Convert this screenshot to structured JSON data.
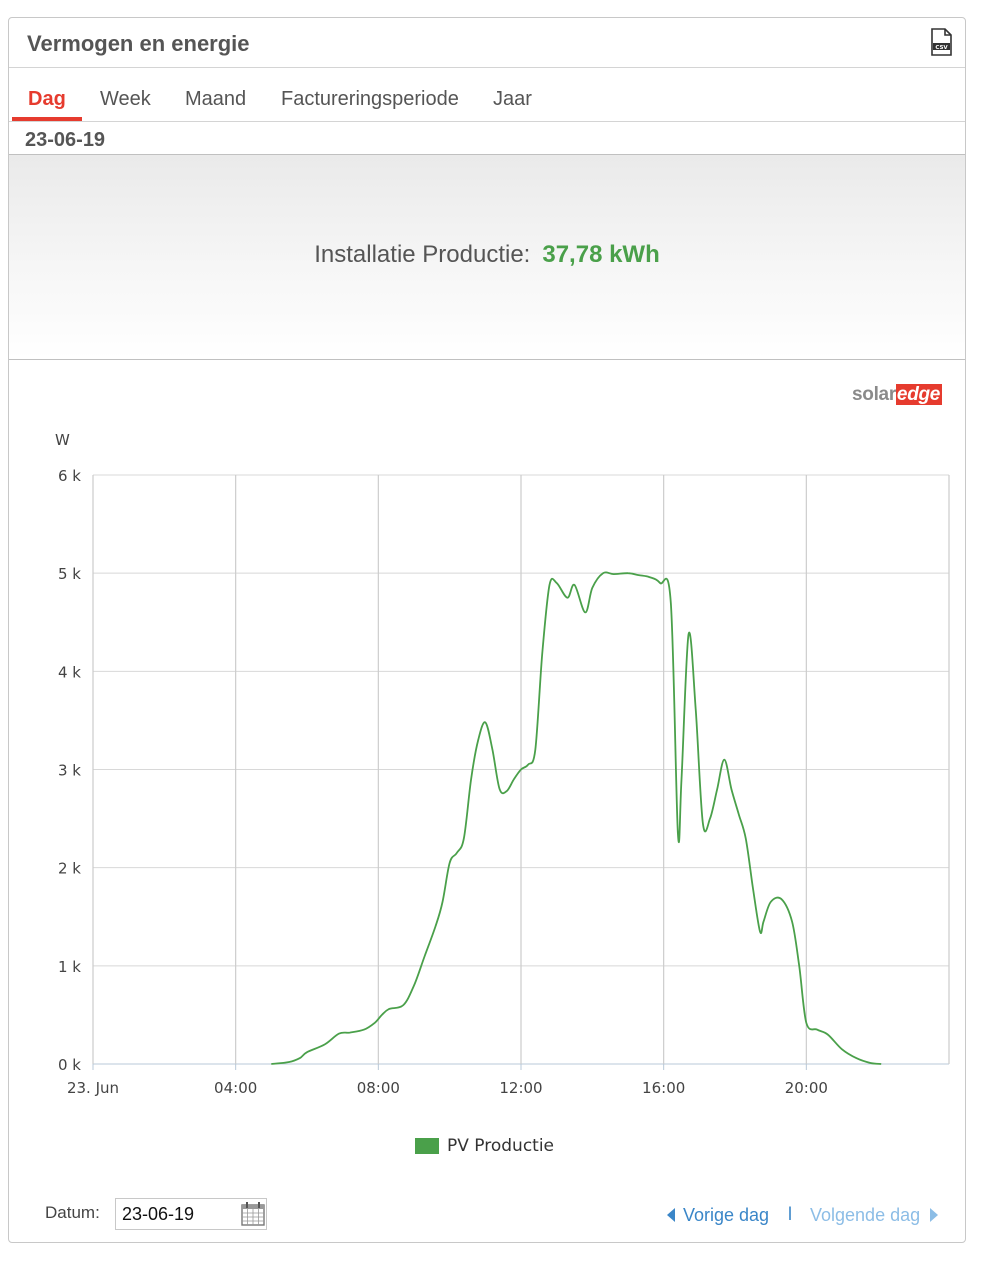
{
  "panel": {
    "title": "Vermogen en energie",
    "export_icon": "csv-file-icon"
  },
  "tabs": [
    {
      "label": "Dag",
      "active": true
    },
    {
      "label": "Week",
      "active": false
    },
    {
      "label": "Maand",
      "active": false
    },
    {
      "label": "Factureringsperiode",
      "active": false
    },
    {
      "label": "Jaar",
      "active": false
    }
  ],
  "period": {
    "date": "23-06-19"
  },
  "summary": {
    "label": "Installatie Productie:",
    "value": "37,78 kWh"
  },
  "logo": {
    "part1": "solar",
    "part2": "edge"
  },
  "colors": {
    "accent": "#e63b2e",
    "series": "#4aa04a",
    "link": "#3a86c8",
    "link_disabled": "#8cbde6"
  },
  "chart_data": {
    "type": "area",
    "ylabel": "W",
    "ylim": [
      0,
      6000
    ],
    "yticks": [
      0,
      1000,
      2000,
      3000,
      4000,
      5000,
      6000
    ],
    "ytick_labels": [
      "0 k",
      "1 k",
      "2 k",
      "3 k",
      "4 k",
      "5 k",
      "6 k"
    ],
    "xlim": [
      0,
      24
    ],
    "xticks": [
      0,
      4,
      8,
      12,
      16,
      20
    ],
    "xtick_labels": [
      "23. Jun",
      "04:00",
      "08:00",
      "12:00",
      "16:00",
      "20:00"
    ],
    "grid": true,
    "legend_position": "bottom-center",
    "series": [
      {
        "name": "PV Productie",
        "color": "#4aa04a",
        "x": [
          0,
          5.0,
          5.5,
          5.8,
          6.0,
          6.5,
          6.9,
          7.2,
          7.6,
          7.9,
          8.1,
          8.3,
          8.7,
          9.0,
          9.3,
          9.6,
          9.8,
          10.0,
          10.2,
          10.4,
          10.6,
          10.8,
          11.0,
          11.2,
          11.4,
          11.6,
          11.8,
          12.0,
          12.2,
          12.4,
          12.6,
          12.8,
          13.0,
          13.3,
          13.5,
          13.8,
          14.0,
          14.3,
          14.6,
          15.0,
          15.3,
          15.6,
          15.9,
          16.2,
          16.4,
          16.5,
          16.7,
          16.9,
          17.1,
          17.3,
          17.5,
          17.7,
          17.9,
          18.1,
          18.3,
          18.5,
          18.7,
          18.8,
          19.0,
          19.3,
          19.6,
          19.8,
          20.0,
          20.3,
          20.6,
          21.0,
          21.4,
          21.8,
          22.1
        ],
        "values": [
          0,
          0,
          20,
          60,
          120,
          200,
          310,
          320,
          350,
          420,
          500,
          560,
          600,
          800,
          1100,
          1400,
          1650,
          2050,
          2150,
          2300,
          2900,
          3300,
          3480,
          3200,
          2800,
          2780,
          2900,
          3000,
          3050,
          3200,
          4200,
          4880,
          4900,
          4750,
          4880,
          4600,
          4850,
          5000,
          4990,
          5000,
          4980,
          4960,
          4900,
          4700,
          2350,
          2900,
          4380,
          3600,
          2450,
          2500,
          2800,
          3100,
          2800,
          2550,
          2300,
          1800,
          1350,
          1450,
          1650,
          1680,
          1450,
          1000,
          420,
          350,
          300,
          150,
          60,
          10,
          0
        ]
      }
    ]
  },
  "datum": {
    "label": "Datum:",
    "value": "23-06-19"
  },
  "nav": {
    "prev": "Vorige dag",
    "separator": "l",
    "next": "Volgende dag"
  }
}
